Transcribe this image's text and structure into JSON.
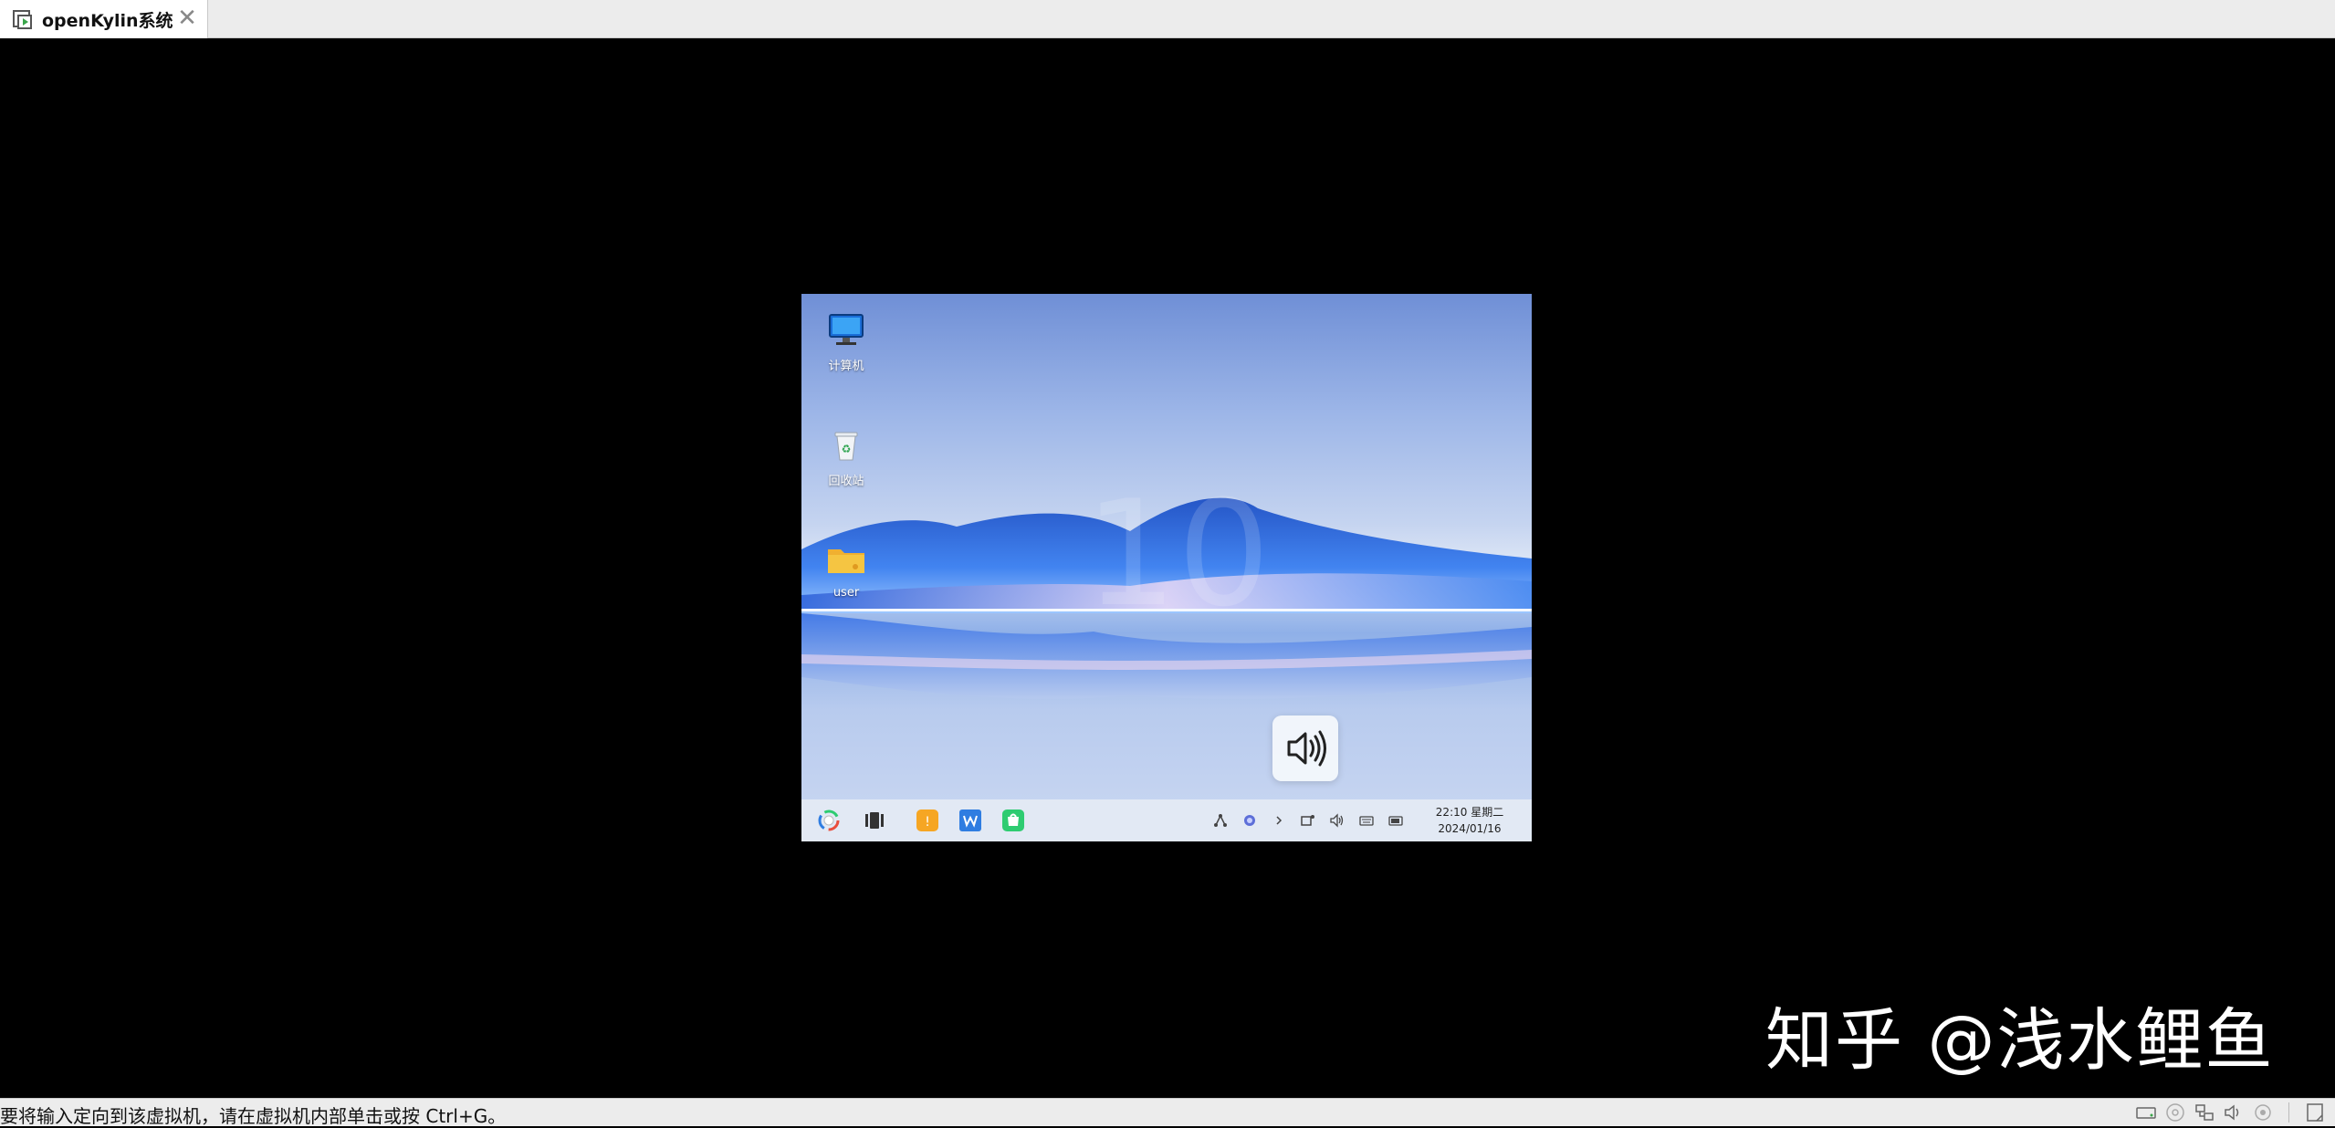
{
  "tab": {
    "title": "openKylin系统",
    "icon": "vm-icon",
    "close_icon": "close-icon"
  },
  "desktop": {
    "icons": [
      {
        "name": "computer-icon",
        "label": "计算机"
      },
      {
        "name": "recycle-bin-icon",
        "label": "回收站"
      },
      {
        "name": "folder-icon",
        "label": "user"
      }
    ]
  },
  "osd": {
    "icon": "volume-icon"
  },
  "taskbar": {
    "apps": [
      "start-menu-icon",
      "multitask-icon",
      "app-store-icon",
      "wps-icon",
      "software-center-icon"
    ],
    "tray": [
      "network-icon",
      "input-method-icon",
      "expand-tray-icon",
      "notification-icon",
      "volume-icon",
      "keyboard-icon",
      "battery-icon"
    ],
    "time": "22:10 星期二",
    "date": "2024/01/16"
  },
  "watermark": "知乎 @浅水鲤鱼",
  "statusbar": {
    "message": "要将输入定向到该虚拟机，请在虚拟机内部单击或按 Ctrl+G。",
    "icons": [
      "hard-disk-icon",
      "cd-icon",
      "network-adapter-icon",
      "sound-icon",
      "usb-icon",
      "message-log-icon"
    ]
  },
  "colors": {
    "taskbar_bg": "#e4eaf4",
    "folder": "#f5c542",
    "store": "#f6a623",
    "wps": "#2f7de1",
    "software_center": "#2ecc71"
  }
}
